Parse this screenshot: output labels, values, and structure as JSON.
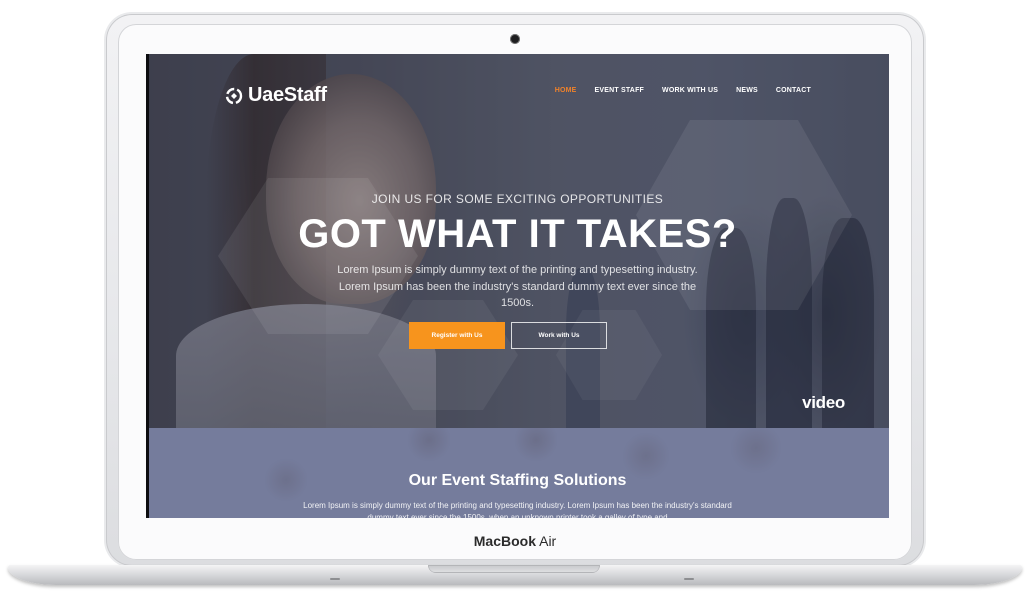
{
  "device": {
    "brand_bold": "MacBook",
    "brand_model": "Air"
  },
  "site": {
    "logo_text": "UaeStaff",
    "nav": [
      {
        "label": "HOME",
        "active": true
      },
      {
        "label": "EVENT STAFF",
        "active": false
      },
      {
        "label": "WORK WITH US",
        "active": false
      },
      {
        "label": "NEWS",
        "active": false
      },
      {
        "label": "CONTACT",
        "active": false
      }
    ],
    "hero": {
      "kicker": "JOIN US FOR SOME EXCITING OPPORTUNITIES",
      "headline": "GOT WHAT IT TAKES?",
      "subtext": "Lorem Ipsum is simply dummy text of the printing and typesetting industry. Lorem Ipsum has been the industry's standard dummy text ever since the 1500s.",
      "primary_button": "Register with Us",
      "secondary_button": "Work with Us",
      "video_label": "video"
    },
    "solutions": {
      "title": "Our Event Staffing Solutions",
      "text": "Lorem Ipsum is simply dummy text of the printing and typesetting industry. Lorem Ipsum has been the industry's standard dummy text ever since the 1500s, when an unknown printer took a galley of type and"
    }
  },
  "colors": {
    "accent": "#f7941d",
    "nav_active": "#f0822a"
  }
}
